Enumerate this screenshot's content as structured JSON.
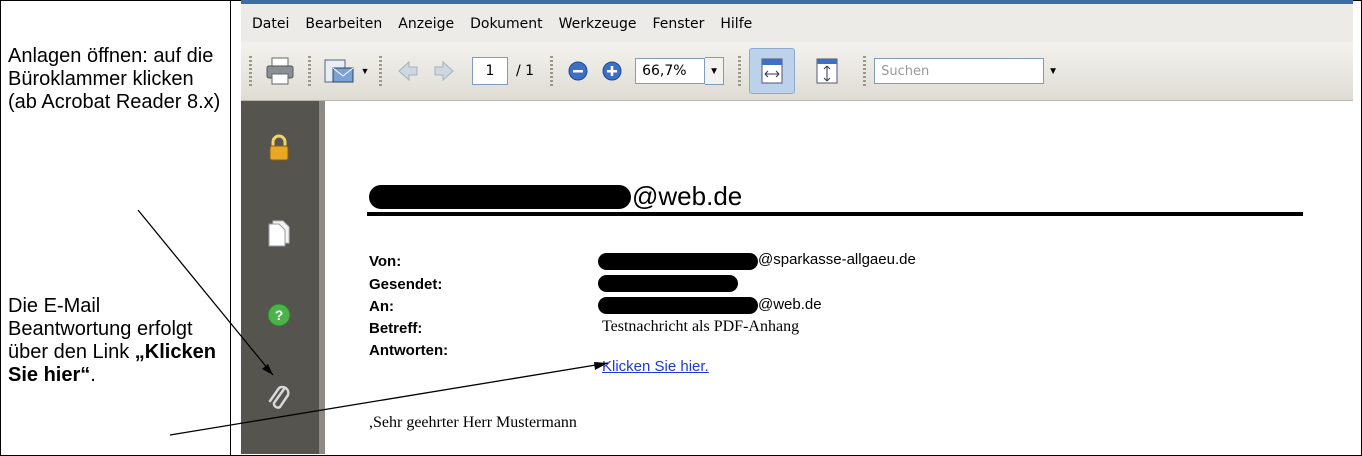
{
  "annotations": {
    "note1": "Anlagen öffnen: auf die Büroklammer klicken (ab Acrobat Reader 8.x)",
    "note2_prefix": "Die E-Mail Beantwortung erfolgt über den Link ",
    "note2_bold": "„Klicken Sie hier“",
    "note2_suffix": "."
  },
  "menu": [
    "Datei",
    "Bearbeiten",
    "Anzeige",
    "Dokument",
    "Werkzeuge",
    "Fenster",
    "Hilfe"
  ],
  "toolbar": {
    "page_current": "1",
    "page_total": "/ 1",
    "zoom": "66,7%",
    "search_placeholder": "Suchen"
  },
  "document": {
    "email_domain": "@web.de",
    "labels": {
      "from": "Von:",
      "sent": "Gesendet:",
      "to": "An:",
      "subject": "Betreff:",
      "reply": "Antworten:"
    },
    "from_domain": "@sparkasse-allgaeu.de",
    "to_domain": "@web.de",
    "subject": "Testnachricht als PDF-Anhang",
    "reply_link": "Klicken Sie hier.",
    "greeting": ",Sehr geehrter Herr Mustermann"
  },
  "colors": {
    "accent": "#3a6ea5",
    "link": "#1a3bd6",
    "sidebar": "#55544f"
  }
}
